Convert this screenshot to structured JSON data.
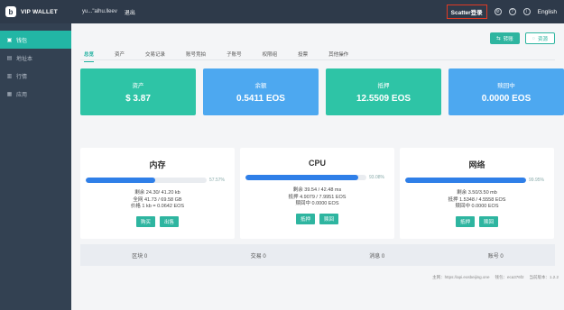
{
  "app": {
    "name": "VIP WALLET",
    "logo_letter": "b"
  },
  "topbar": {
    "account": "yu...\"alhu.lleev",
    "logout": "退出",
    "scatter_login": "Scatter登录",
    "language": "English",
    "icons": [
      "gear-icon",
      "help-icon",
      "info-icon"
    ]
  },
  "sidebar": {
    "items": [
      {
        "label": "钱包",
        "icon": "wallet-icon",
        "active": true
      },
      {
        "label": "地址本",
        "icon": "address-book-icon",
        "active": false
      },
      {
        "label": "行情",
        "icon": "chart-icon",
        "active": false
      },
      {
        "label": "应用",
        "icon": "apps-icon",
        "active": false
      }
    ]
  },
  "actions": {
    "transfer": "转账",
    "resources": "资源"
  },
  "tabs": [
    "总览",
    "资产",
    "交易记录",
    "账号竞拍",
    "子账号",
    "权限组",
    "投票",
    "其他操作"
  ],
  "stats": [
    {
      "label": "资产",
      "value": "$ 3.87",
      "color": "#2ec4a6"
    },
    {
      "label": "余额",
      "value": "0.5411 EOS",
      "color": "#4da8f0"
    },
    {
      "label": "抵押",
      "value": "12.5509 EOS",
      "color": "#2ec4a6"
    },
    {
      "label": "赎回中",
      "value": "0.0000 EOS",
      "color": "#4da8f0"
    }
  ],
  "resources": [
    {
      "title": "内存",
      "percent_label": "57.57%",
      "fill": 0.5757,
      "lines": [
        "剩余 24.30/ 41.20 kb",
        "全网 41.73 / 69.58 GB",
        "价格 1 kb = 0.0642 EOS"
      ],
      "buttons": [
        "购买",
        "出售"
      ]
    },
    {
      "title": "CPU",
      "percent_label": "93.08%",
      "fill": 0.9308,
      "lines": [
        "剩余 39.54 / 42.48 ms",
        "抵押 4.9079 / 7.9951 EOS",
        "赎回中 0.0000 EOS"
      ],
      "buttons": [
        "抵押",
        "赎回"
      ]
    },
    {
      "title": "网络",
      "percent_label": "99.95%",
      "fill": 0.9995,
      "lines": [
        "剩余 3.50/3.50 mb",
        "抵押 1.5348 / 4.5558 EOS",
        "赎回中 0.0000 EOS"
      ],
      "buttons": [
        "抵押",
        "赎回"
      ]
    }
  ],
  "summary": [
    "区块 0",
    "交易 0",
    "消息 0",
    "账号 0"
  ],
  "footer": [
    "主网：https://api.eosbeijing.one",
    "钱包：eca376f2",
    "当前版本：1.2.2"
  ]
}
